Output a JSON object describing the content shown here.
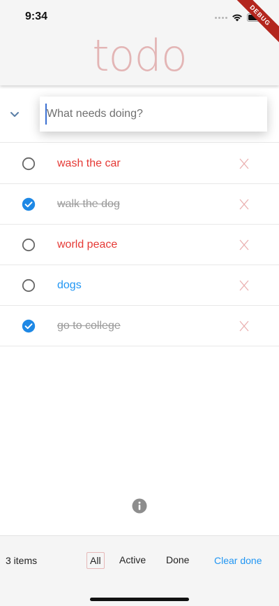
{
  "status_bar": {
    "time": "9:34",
    "debug_label": "DEBUG"
  },
  "app": {
    "title": "todo"
  },
  "new_todo": {
    "placeholder": "What needs doing?",
    "value": ""
  },
  "todos": [
    {
      "title": "wash the car",
      "done": false
    },
    {
      "title": "walk the dog",
      "done": true
    },
    {
      "title": "world peace",
      "done": false
    },
    {
      "title": "dogs",
      "done": false
    },
    {
      "title": "go to college",
      "done": true
    }
  ],
  "footer": {
    "count_label": "3 items",
    "filters": [
      "All",
      "Active",
      "Done"
    ],
    "selected_filter": "All",
    "clear_label": "Clear done"
  },
  "colors": {
    "accent_blue": "#2196f3",
    "todo_red": "#e53935",
    "title_pink": "#e3b5b5",
    "done_gray": "#9a9a9a"
  },
  "icons": {
    "toggle_all": "chevron-down-icon",
    "unchecked": "radio-unchecked-icon",
    "checked": "check-circle-icon",
    "delete": "close-icon",
    "info": "info-icon"
  }
}
